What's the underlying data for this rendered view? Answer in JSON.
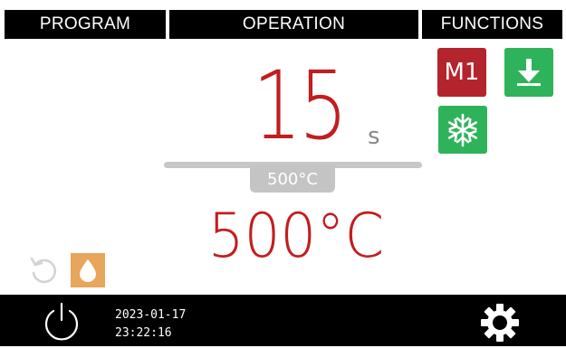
{
  "tabs": [
    {
      "label": "PROGRAM"
    },
    {
      "label": "OPERATION"
    },
    {
      "label": "FUNCTIONS"
    }
  ],
  "operation": {
    "time_value": "15",
    "time_unit": "s",
    "set_temperature": "500°C",
    "actual_temperature": "500°C"
  },
  "functions": {
    "memory_label": "M1",
    "memory_icon": "memory-m1",
    "download_icon": "download-arrow-icon",
    "cooling_icon": "snowflake-icon"
  },
  "footer": {
    "date": "2023-01-17",
    "time": "23:22:16"
  },
  "colors": {
    "accent_red": "#c21d1f",
    "memory_red": "#b4242d",
    "function_green": "#2fb35a",
    "drop_orange": "#e8a55c",
    "bar_black": "#000000",
    "slider_grey": "#c7c7c7"
  }
}
